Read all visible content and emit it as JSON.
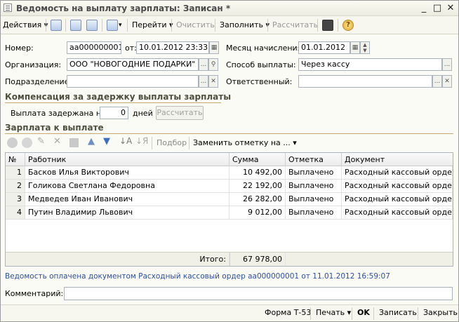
{
  "window": {
    "title": "Ведомость на выплату зарплаты: Записан *"
  },
  "toolbar": {
    "actions": "Действия",
    "goto": "Перейти",
    "clear": "Очистить",
    "fill": "Заполнить",
    "calc": "Рассчитать"
  },
  "header": {
    "number_label": "Номер:",
    "number_value": "аа000000001",
    "date_label": "от:",
    "date_value": "10.01.2012 23:33:34",
    "month_label": "Месяц начисления:",
    "month_value": "01.01.2012",
    "org_label": "Организация:",
    "org_value": "ООО \"НОВОГОДНИЕ ПОДАРКИ\"",
    "payment_label": "Способ выплаты:",
    "payment_value": "Через кассу",
    "dept_label": "Подразделение:",
    "dept_value": "",
    "resp_label": "Ответственный:",
    "resp_value": ""
  },
  "compensation": {
    "title": "Компенсация за задержку выплаты зарплаты",
    "delay_label": "Выплата задержана на:",
    "delay_value": "0",
    "days_label": "дней",
    "calc_button": "Рассчитать"
  },
  "salary": {
    "title": "Зарплата к выплате",
    "selection": "Подбор",
    "replace_mark": "Заменить отметку на ..."
  },
  "table": {
    "headers": [
      "№",
      "Работник",
      "Сумма",
      "Отметка",
      "Документ"
    ],
    "rows": [
      {
        "n": "1",
        "employee": "Басков Илья Викторович",
        "sum": "10 492,00",
        "mark": "Выплачено",
        "doc": "Расходный кассовый орде..."
      },
      {
        "n": "2",
        "employee": "Голикова Светлана Федоровна",
        "sum": "22 192,00",
        "mark": "Выплачено",
        "doc": "Расходный кассовый орде..."
      },
      {
        "n": "3",
        "employee": "Медведев Иван Иванович",
        "sum": "26 282,00",
        "mark": "Выплачено",
        "doc": "Расходный кассовый орде..."
      },
      {
        "n": "4",
        "employee": "Путин Владимир Львович",
        "sum": "9 012,00",
        "mark": "Выплачено",
        "doc": "Расходный кассовый орде..."
      }
    ],
    "total_label": "Итого:",
    "total_value": "67 978,00"
  },
  "paid_info": "Ведомость оплачена документом Расходный кассовый ордер аа000000001 от 11.01.2012 16:59:07",
  "comment": {
    "label": "Комментарий:",
    "value": ""
  },
  "footer": {
    "form": "Форма Т-53",
    "print": "Печать",
    "ok": "OK",
    "save": "Записать",
    "close": "Закрыть"
  }
}
